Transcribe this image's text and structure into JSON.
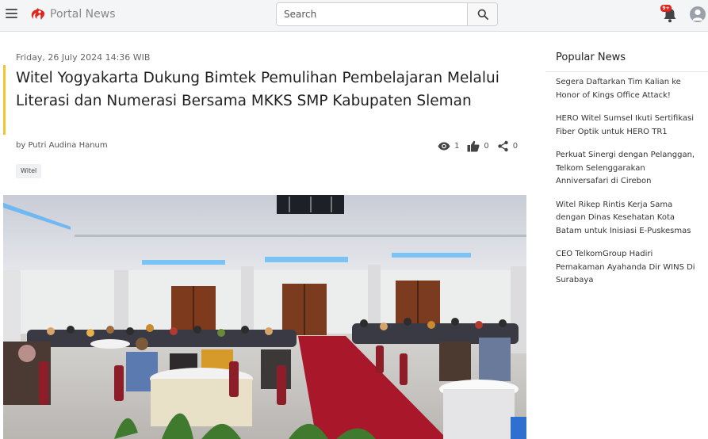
{
  "header": {
    "brand": "Portal News",
    "search_placeholder": "Search",
    "notification_badge": "9+"
  },
  "article": {
    "date": "Friday, 26 July 2024 14:36 WIB",
    "title": "Witel Yogyakarta Dukung Bimtek Pemulihan Pembelajaran Melalui Literasi dan Numerasi Bersama MKKS SMP Kabupaten Sleman",
    "author": "by Putri Audina Hanum",
    "views": "1",
    "likes": "0",
    "shares": "0",
    "tag": "Witel"
  },
  "sidebar": {
    "title": "Popular News",
    "items": [
      "Segera Daftarkan Tim Kalian ke Honor of Kings Office Attack!",
      "HERO Witel Sumsel Ikuti Sertifikasi Fiber Optik untuk HERO TR1",
      "Perkuat Sinergi dengan Pelanggan, Telkom Selenggarakan Anniversafari di Cirebon",
      "Witel Rikep Rintis Kerja Sama dengan Dinas Kesehatan Kota Batam untuk Inisiasi E-Puskesmas",
      "CEO TelkomGroup Hadiri Pemakaman Ayahanda Dir WINS Di Surabaya"
    ]
  },
  "colors": {
    "accent_bar": "#f4c430",
    "logo_red": "#e0261c",
    "badge_red": "#e0261c"
  },
  "icons": [
    "menu-icon",
    "logo-icon",
    "search-icon",
    "bell-icon",
    "user-icon",
    "eye-icon",
    "thumbs-up-icon",
    "share-icon"
  ]
}
